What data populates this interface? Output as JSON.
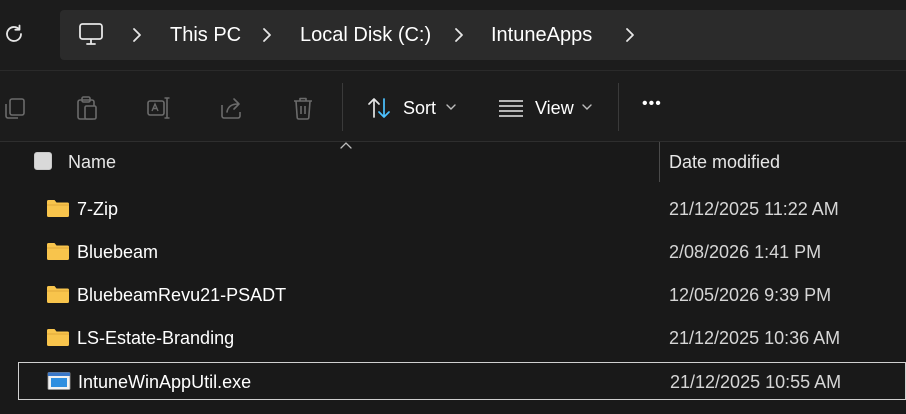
{
  "breadcrumb": {
    "items": [
      "This PC",
      "Local Disk (C:)",
      "IntuneApps"
    ]
  },
  "toolbar": {
    "sort_label": "Sort",
    "view_label": "View",
    "more_label": "•••"
  },
  "columns": {
    "name": "Name",
    "date_modified": "Date modified"
  },
  "files": [
    {
      "name": "7-Zip",
      "date": "21/12/2025 11:22 AM",
      "type": "folder"
    },
    {
      "name": "Bluebeam",
      "date": "2/08/2026 1:41 PM",
      "type": "folder"
    },
    {
      "name": "BluebeamRevu21-PSADT",
      "date": "12/05/2026 9:39 PM",
      "type": "folder"
    },
    {
      "name": "LS-Estate-Branding",
      "date": "21/12/2025 10:36 AM",
      "type": "folder"
    },
    {
      "name": "IntuneWinAppUtil.exe",
      "date": "21/12/2025 10:55 AM",
      "type": "exe",
      "selected": true
    }
  ],
  "colors": {
    "background": "#191919",
    "folder": "#f8c44c",
    "accent": "#4cc2ff"
  }
}
